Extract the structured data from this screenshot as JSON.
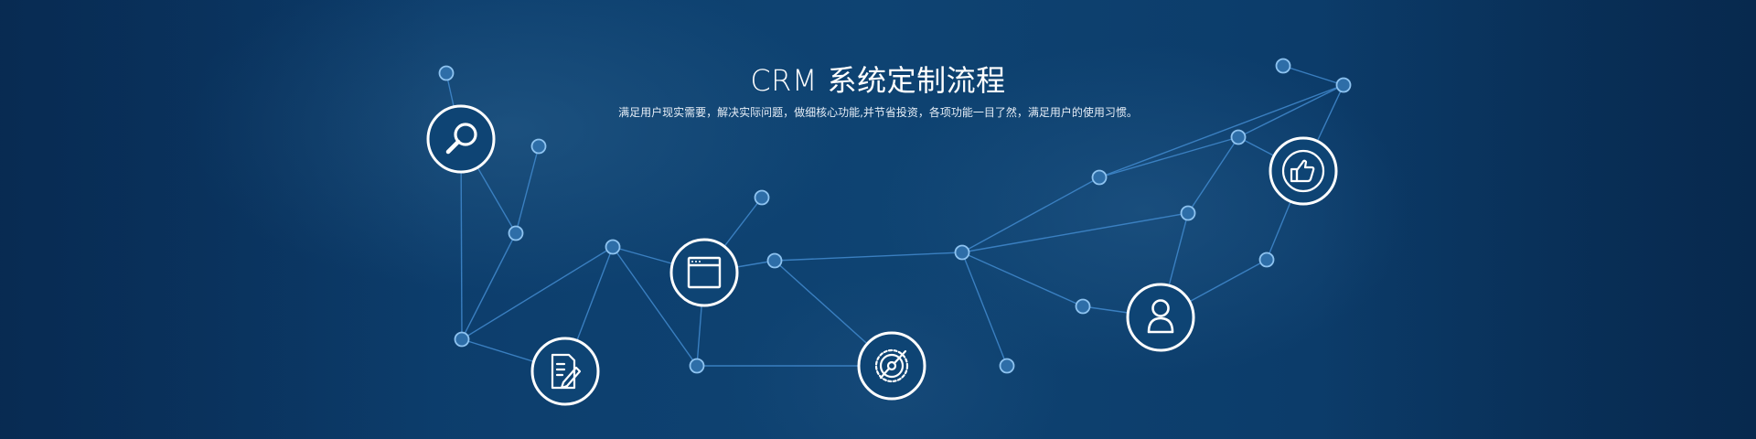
{
  "banner": {
    "title": "CRM 系统定制流程",
    "subtitle": "满足用户现实需要，解决实际问题，做细核心功能,并节省投资，各项功能一目了然，满足用户的使用习惯。"
  },
  "steps": [
    {
      "icon": "search-icon"
    },
    {
      "icon": "document-edit-icon"
    },
    {
      "icon": "browser-window-icon"
    },
    {
      "icon": "gear-icon"
    },
    {
      "icon": "user-icon"
    },
    {
      "icon": "thumbs-up-icon"
    }
  ],
  "colors": {
    "background": "#0b3a66",
    "line": "#3f86c9",
    "node_fill": "#2e6ea8",
    "node_stroke": "#8ec3f0",
    "icon_stroke": "#ffffff"
  }
}
